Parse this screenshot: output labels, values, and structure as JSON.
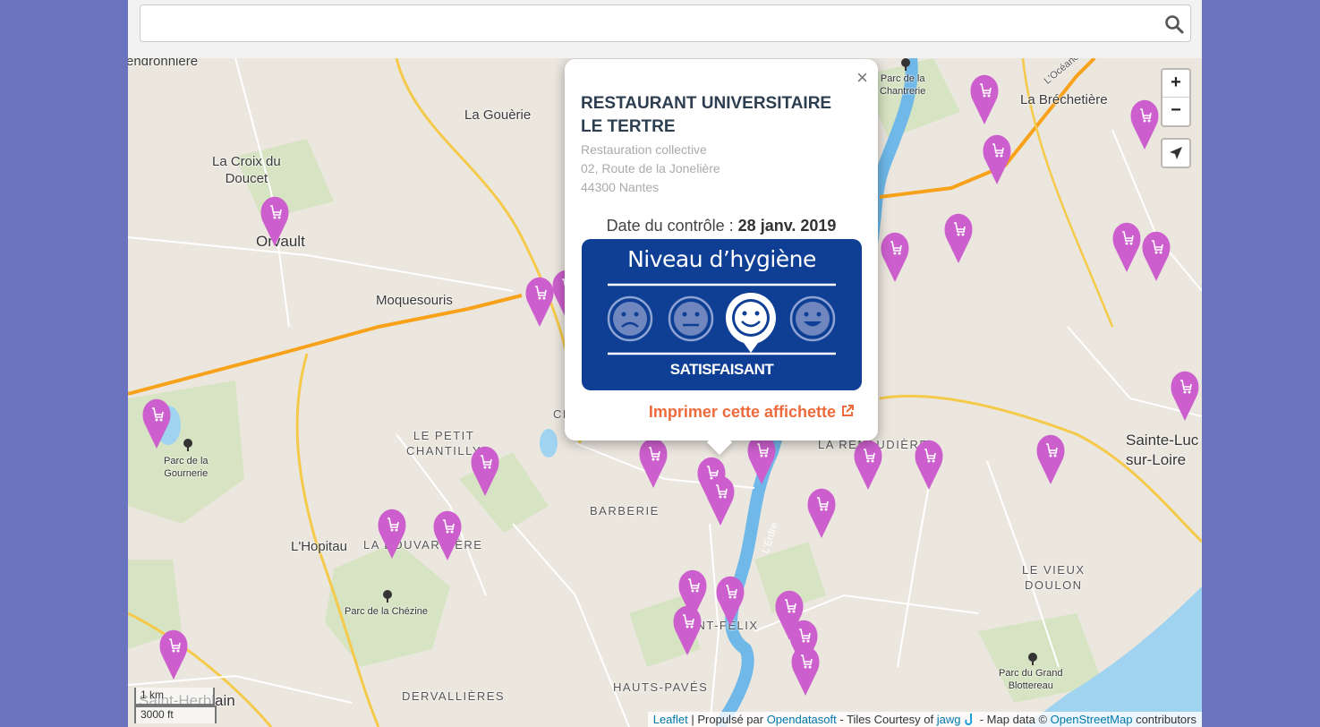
{
  "search": {
    "value": "",
    "placeholder": ""
  },
  "zoom": {
    "in_label": "+",
    "out_label": "−"
  },
  "scale": {
    "metric": "1 km",
    "imperial": "3000 ft"
  },
  "attribution": {
    "leaflet": "Leaflet",
    "sep1": " | Propulsé par ",
    "opendatasoft": "Opendatasoft",
    "tiles": " - Tiles Courtesy of ",
    "jawg": "jawg",
    "mapdata": " - Map data © ",
    "osm": "OpenStreetMap",
    "contrib": " contributors"
  },
  "popup": {
    "close": "×",
    "name": "RESTAURANT UNIVERSITAIRE LE TERTRE",
    "category": "Restauration collective",
    "street": "02, Route de la Jonelière",
    "city": "44300 Nantes",
    "date_label": "Date du contrôle : ",
    "date_value": "28 janv. 2019",
    "badge_title": "Niveau d’hygiène",
    "badge_level": "SATISFAISANT",
    "print_label": "Imprimer cette affichette"
  },
  "map_labels": [
    {
      "name": "label-gendronniere",
      "text": "endronniere"
    },
    {
      "name": "label-la-gouerie",
      "text": "La Gouèrie"
    },
    {
      "name": "label-la-croix-du-doucet",
      "text": "La Croix du\nDoucet"
    },
    {
      "name": "label-orvault",
      "text": "Orvault"
    },
    {
      "name": "label-moquesouris",
      "text": "Moquesouris"
    },
    {
      "name": "label-parc-chantrerie",
      "text": "Parc de la\nChantrerie"
    },
    {
      "name": "label-la-brechetiere",
      "text": "La Bréchetière"
    },
    {
      "name": "label-oceane",
      "text": "L'Océane"
    },
    {
      "name": "label-le-petit-chantilly",
      "text": "LE PETIT\nCHANTILLY"
    },
    {
      "name": "label-parc-gournerie",
      "text": "Parc de la\nGournerie"
    },
    {
      "name": "label-ch",
      "text": "CH"
    },
    {
      "name": "label-barberie",
      "text": "BARBERIE"
    },
    {
      "name": "label-la-renaudiere",
      "text": "LA RENAUDIÈRE"
    },
    {
      "name": "label-sainte-luce",
      "text": "Sainte-Luc\nsur-Loire"
    },
    {
      "name": "label-lhopitau",
      "text": "L'Hopitau"
    },
    {
      "name": "label-la-bouvardiere",
      "text": "LA BOUVARDIÈRE"
    },
    {
      "name": "label-erdre",
      "text": "L'Erdre"
    },
    {
      "name": "label-le-vieux-doulon",
      "text": "LE VIEUX\nDOULON"
    },
    {
      "name": "label-parc-chezine",
      "text": "Parc de la Chézine"
    },
    {
      "name": "label-saint-felix",
      "text": "SAINT-FÉLIX"
    },
    {
      "name": "label-parc-grand-blottereau",
      "text": "Parc du Grand\nBlottereau"
    },
    {
      "name": "label-saint-herblain",
      "text": "Saint-Herblain"
    },
    {
      "name": "label-dervallieres",
      "text": "DERVALLIÈRES"
    },
    {
      "name": "label-hauts-paves",
      "text": "HAUTS-PAVÉS"
    }
  ],
  "colors": {
    "marker": "#cc5fcd",
    "badge_bg": "#0f3f95",
    "print_link": "#ec6a3c",
    "page_bg": "#6a73bd"
  },
  "icons": {
    "search": "search-icon",
    "locate": "locate-arrow-icon",
    "marker": "cart-marker-icon",
    "external": "external-link-icon"
  }
}
